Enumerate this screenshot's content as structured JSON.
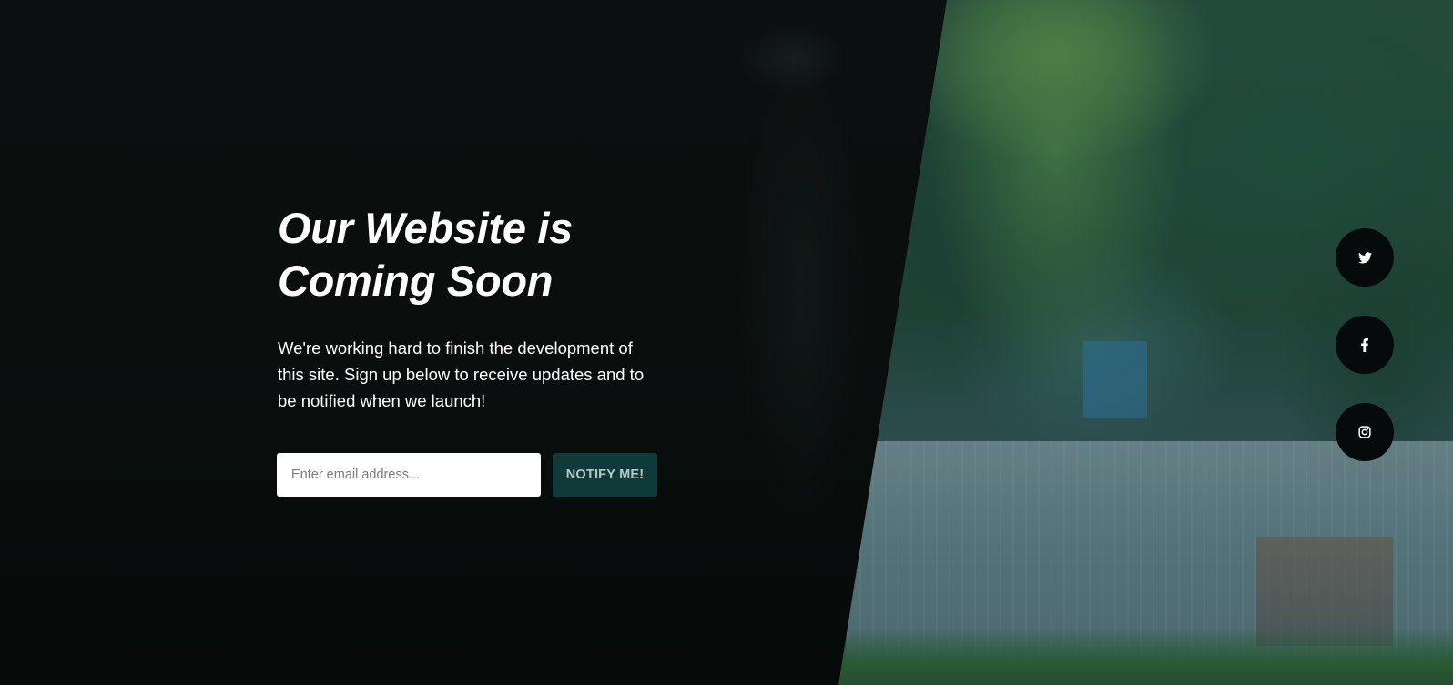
{
  "hero": {
    "headline": "Our Website is Coming Soon",
    "description": "We're working hard to finish the development of this site. Sign up below to receive updates and to be notified when we launch!"
  },
  "signup": {
    "email_placeholder": "Enter email address...",
    "email_value": "",
    "button_label": "NOTIFY ME!"
  },
  "social": [
    {
      "icon": "twitter-icon",
      "network": "Twitter"
    },
    {
      "icon": "facebook-icon",
      "network": "Facebook"
    },
    {
      "icon": "instagram-icon",
      "network": "Instagram"
    }
  ],
  "colors": {
    "overlay": "#0a0f0e",
    "button_bg": "#0f3a3a",
    "button_text": "#b9c6c4",
    "social_bg": "#070a0a"
  }
}
